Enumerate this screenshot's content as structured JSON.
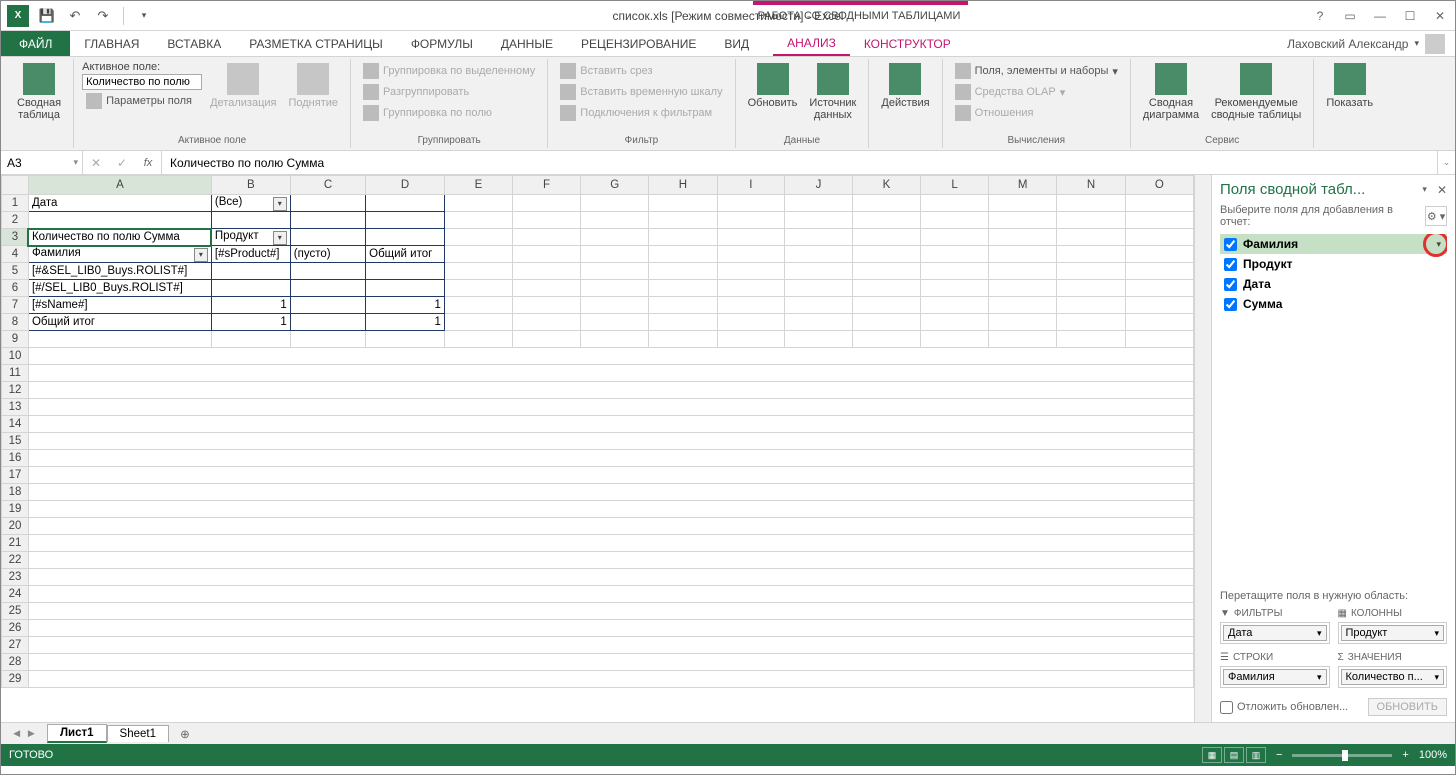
{
  "titlebar": {
    "app": "X ≡",
    "doc_title": "список.xls  [Режим совместимости] - Excel",
    "tools_title": "РАБОТА СО СВОДНЫМИ ТАБЛИЦАМИ"
  },
  "ribbon_tabs": {
    "file": "ФАЙЛ",
    "home": "ГЛАВНАЯ",
    "insert": "ВСТАВКА",
    "layout": "РАЗМЕТКА СТРАНИЦЫ",
    "formulas": "ФОРМУЛЫ",
    "data": "ДАННЫЕ",
    "review": "РЕЦЕНЗИРОВАНИЕ",
    "view": "ВИД",
    "analyze": "АНАЛИЗ",
    "design": "КОНСТРУКТОР"
  },
  "user": {
    "name": "Лаховский Александр"
  },
  "ribbon": {
    "pivot": {
      "btn": "Сводная\nтаблица"
    },
    "active_field": {
      "group": "Активное поле",
      "label": "Активное поле:",
      "value": "Количество по полю",
      "settings": "Параметры поля",
      "drill_down": "Детализация",
      "drill_up": "Поднятие"
    },
    "group": {
      "label": "Группировать",
      "sel": "Группировка по выделенному",
      "ungroup": "Разгруппировать",
      "field": "Группировка по полю"
    },
    "filter": {
      "label": "Фильтр",
      "slicer": "Вставить срез",
      "timeline": "Вставить временную шкалу",
      "conn": "Подключения к фильтрам"
    },
    "data_grp": {
      "label": "Данные",
      "refresh": "Обновить",
      "source": "Источник\nданных"
    },
    "actions": {
      "btn": "Действия"
    },
    "calc": {
      "label": "Вычисления",
      "fields": "Поля, элементы и наборы",
      "olap": "Средства OLAP",
      "rel": "Отношения"
    },
    "tools": {
      "label": "Сервис",
      "chart": "Сводная\nдиаграмма",
      "rec": "Рекомендуемые\nсводные таблицы"
    },
    "show": {
      "btn": "Показать"
    }
  },
  "formula_bar": {
    "name_box": "A3",
    "formula": "Количество по полю Сумма"
  },
  "columns": [
    "A",
    "B",
    "C",
    "D",
    "E",
    "F",
    "G",
    "H",
    "I",
    "J",
    "K",
    "L",
    "M",
    "N",
    "O"
  ],
  "cells": {
    "r1": {
      "A": "Дата",
      "B": "(Все)"
    },
    "r3": {
      "A": "Количество по полю Сумма",
      "B": "Продукт"
    },
    "r4": {
      "A": "Фамилия",
      "B": "[#sProduct#]",
      "C": "(пусто)",
      "D": "Общий итог"
    },
    "r5": {
      "A": "[#&SEL_LIB0_Buys.ROLIST#]"
    },
    "r6": {
      "A": "[#/SEL_LIB0_Buys.ROLIST#]"
    },
    "r7": {
      "A": "[#sName#]",
      "B": "1",
      "D": "1"
    },
    "r8": {
      "A": "Общий итог",
      "B": "1",
      "D": "1"
    }
  },
  "pivot_panel": {
    "title": "Поля сводной табл...",
    "sub": "Выберите поля для добавления в отчет:",
    "fields": [
      "Фамилия",
      "Продукт",
      "Дата",
      "Сумма"
    ],
    "drag": "Перетащите поля в нужную область:",
    "areas": {
      "filters": {
        "title": "ФИЛЬТРЫ",
        "item": "Дата"
      },
      "columns": {
        "title": "КОЛОННЫ",
        "item": "Продукт"
      },
      "rows": {
        "title": "СТРОКИ",
        "item": "Фамилия"
      },
      "values": {
        "title": "ЗНАЧЕНИЯ",
        "item": "Количество п..."
      }
    },
    "defer": "Отложить обновлен...",
    "update": "ОБНОВИТЬ"
  },
  "sheets": {
    "s1": "Лист1",
    "s2": "Sheet1"
  },
  "status": {
    "ready": "ГОТОВО",
    "zoom": "100%"
  }
}
